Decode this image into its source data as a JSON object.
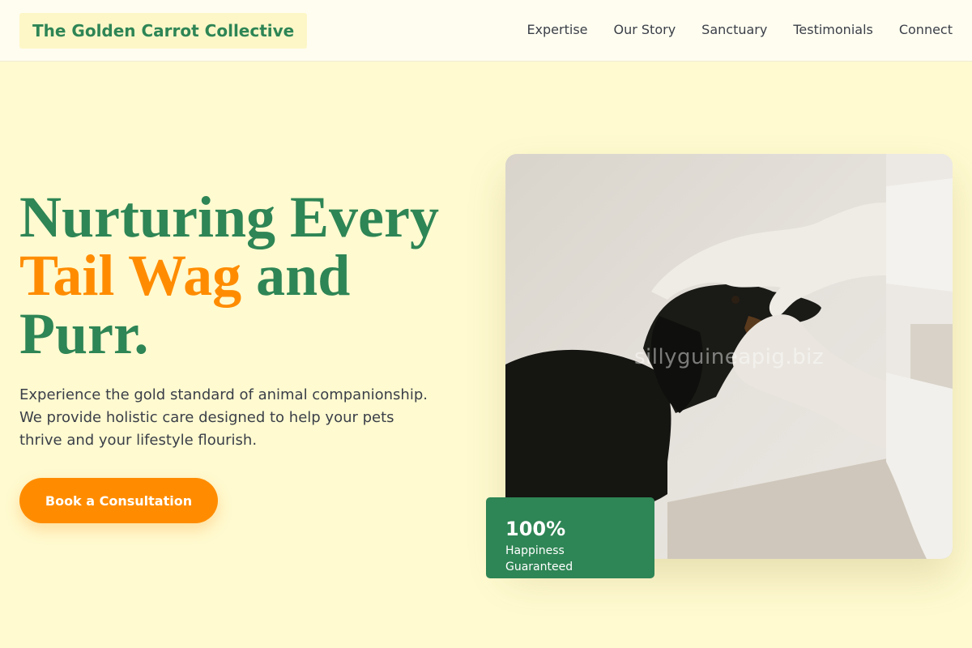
{
  "brand": {
    "name": "The Golden Carrot Collective"
  },
  "nav": {
    "items": [
      {
        "label": "Expertise"
      },
      {
        "label": "Our Story"
      },
      {
        "label": "Sanctuary"
      },
      {
        "label": "Testimonials"
      },
      {
        "label": "Connect"
      }
    ]
  },
  "hero": {
    "title_line1": "Nurturing Every",
    "title_accent": "Tail Wag",
    "title_line2_rest": " and",
    "title_line3": "Purr.",
    "description": "Experience the gold standard of animal companionship. We provide holistic care designed to help your pets thrive and your lifestyle flourish.",
    "cta_label": "Book a Consultation",
    "image_watermark": "sillyguineapig.biz"
  },
  "stat_card": {
    "value": "100%",
    "label": "Happiness Guaranteed"
  },
  "colors": {
    "primary_green": "#2e8555",
    "accent_orange": "#ff8c00",
    "background_cream": "#fffad0"
  }
}
